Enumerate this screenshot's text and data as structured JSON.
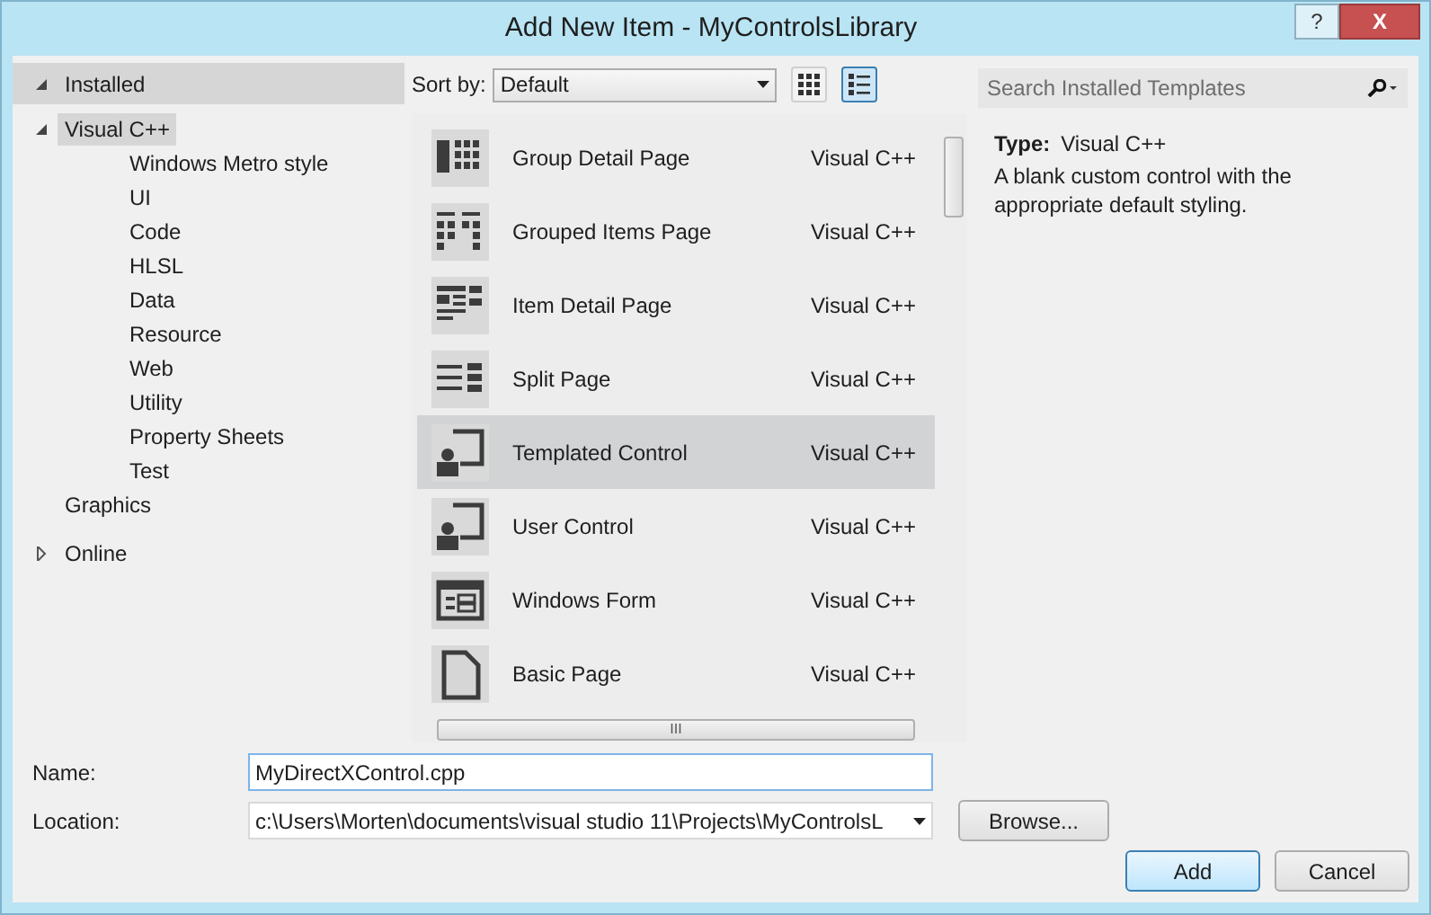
{
  "window": {
    "title": "Add New Item - MyControlsLibrary",
    "help": "?",
    "close": "X"
  },
  "sections": [
    {
      "label": "Installed",
      "expanded": true,
      "selected": true,
      "children": [
        {
          "label": "Visual C++",
          "expanded": true,
          "selected": true,
          "children": [
            {
              "label": "Windows Metro style",
              "selected": false
            },
            {
              "label": "UI",
              "selected": false
            },
            {
              "label": "Code",
              "selected": false
            },
            {
              "label": "HLSL",
              "selected": false
            },
            {
              "label": "Data",
              "selected": false
            },
            {
              "label": "Resource",
              "selected": false
            },
            {
              "label": "Web",
              "selected": false
            },
            {
              "label": "Utility",
              "selected": false
            },
            {
              "label": "Property Sheets",
              "selected": false
            },
            {
              "label": "Test",
              "selected": false
            }
          ]
        },
        {
          "label": "Graphics",
          "selected": false
        }
      ]
    },
    {
      "label": "Online",
      "expanded": false,
      "selected": false
    }
  ],
  "sort": {
    "label": "Sort by:",
    "value": "Default"
  },
  "view_toggle": [
    {
      "kind": "grid",
      "selected": false
    },
    {
      "kind": "list",
      "selected": true
    }
  ],
  "search": {
    "placeholder": "Search Installed Templates"
  },
  "templates": [
    {
      "kind": "group-detail",
      "name": "Group Detail Page",
      "type": "Visual C++",
      "selected": false
    },
    {
      "kind": "grouped-items",
      "name": "Grouped Items Page",
      "type": "Visual C++",
      "selected": false
    },
    {
      "kind": "item-detail",
      "name": "Item Detail Page",
      "type": "Visual C++",
      "selected": false
    },
    {
      "kind": "split",
      "name": "Split Page",
      "type": "Visual C++",
      "selected": false
    },
    {
      "kind": "control",
      "name": "Templated Control",
      "type": "Visual C++",
      "selected": true
    },
    {
      "kind": "control",
      "name": "User Control",
      "type": "Visual C++",
      "selected": false
    },
    {
      "kind": "form",
      "name": "Windows Form",
      "type": "Visual C++",
      "selected": false
    },
    {
      "kind": "page",
      "name": "Basic Page",
      "type": "Visual C++",
      "selected": false
    }
  ],
  "details": {
    "type_label": "Type:",
    "type_value": "Visual C++",
    "description": "A blank custom control with the appropriate default styling."
  },
  "name_field": {
    "label": "Name:",
    "value": "MyDirectXControl.cpp"
  },
  "location_field": {
    "label": "Location:",
    "value": "c:\\Users\\Morten\\documents\\visual studio 11\\Projects\\MyControlsL"
  },
  "buttons": [
    {
      "kind": "browse",
      "label": "Browse..."
    },
    {
      "kind": "default",
      "label": "Add"
    },
    {
      "kind": "normal",
      "label": "Cancel"
    }
  ],
  "scroll_grip": "III"
}
